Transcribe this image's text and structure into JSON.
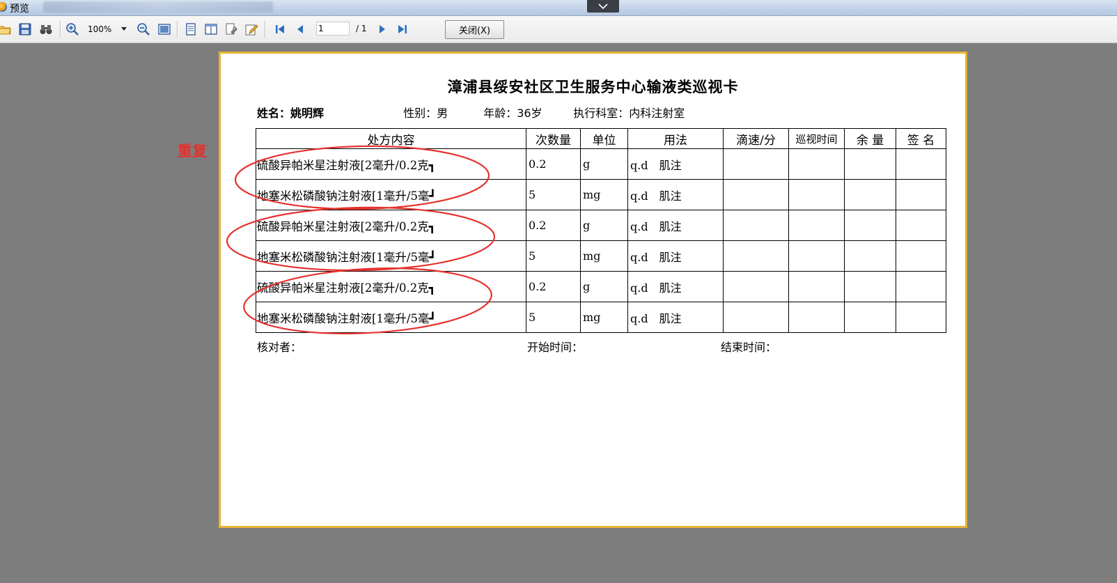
{
  "window": {
    "title": "预览"
  },
  "toolbar": {
    "zoom": "100%",
    "page_current": "1",
    "page_total": "/ 1",
    "close_label": "关闭(X)"
  },
  "document": {
    "title": "漳浦县绥安社区卫生服务中心输液类巡视卡",
    "patient": {
      "name": "姓名：姚明辉",
      "gender": "性别：男",
      "age": "年龄：36岁",
      "department": "执行科室：内科注射室"
    },
    "table": {
      "headers": [
        "处方内容",
        "次数量",
        "单位",
        "用法",
        "滴速/分",
        "巡视时间",
        "余 量",
        "签 名"
      ],
      "rows": [
        [
          "硫酸异帕米星注射液[2毫升/0.2克┓",
          "0.2",
          "g",
          "q.d　肌注",
          "",
          "",
          "",
          ""
        ],
        [
          "地塞米松磷酸钠注射液[1毫升/5毫┛",
          "5",
          "mg",
          "q.d　肌注",
          "",
          "",
          "",
          ""
        ],
        [
          "硫酸异帕米星注射液[2毫升/0.2克┓",
          "0.2",
          "g",
          "q.d　肌注",
          "",
          "",
          "",
          ""
        ],
        [
          "地塞米松磷酸钠注射液[1毫升/5毫┛",
          "5",
          "mg",
          "q.d　肌注",
          "",
          "",
          "",
          ""
        ],
        [
          "硫酸异帕米星注射液[2毫升/0.2克┓",
          "0.2",
          "g",
          "q.d　肌注",
          "",
          "",
          "",
          ""
        ],
        [
          "地塞米松磷酸钠注射液[1毫升/5毫┛",
          "5",
          "mg",
          "q.d　肌注",
          "",
          "",
          "",
          ""
        ]
      ]
    },
    "footer": {
      "checker": "核对者：",
      "start_time": "开始时间：",
      "end_time": "结束时间："
    }
  },
  "annotation": {
    "label": "重复",
    "color": "#e5312d"
  },
  "icons": [
    "app-icon",
    "open-folder-icon",
    "save-icon",
    "binoculars-icon",
    "zoom-in-icon",
    "zoom-out-icon",
    "fit-page-icon",
    "single-page-icon",
    "multi-page-icon",
    "page-setup-icon",
    "edit-icon",
    "first-page-icon",
    "prev-page-icon",
    "next-page-icon",
    "last-page-icon",
    "chevron-down-icon"
  ]
}
